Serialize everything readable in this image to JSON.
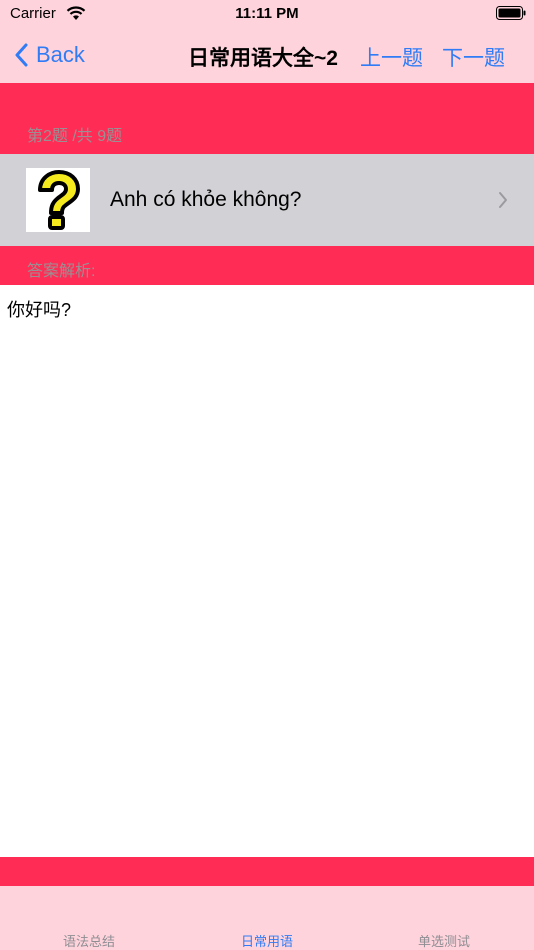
{
  "status_bar": {
    "carrier": "Carrier",
    "time": "11:11 PM"
  },
  "nav": {
    "back_label": "Back",
    "title": "日常用语大全~2",
    "prev_label": "上一题",
    "next_label": "下一题"
  },
  "question_section": {
    "header": "第2题 /共 9题"
  },
  "question": {
    "image_icon": "question-mark-icon",
    "text": "Anh có khỏe không?"
  },
  "answer_section": {
    "header": "答案解析:",
    "text": "你好吗?"
  },
  "tabs": [
    {
      "label": "语法总结",
      "active": false
    },
    {
      "label": "日常用语",
      "active": true
    },
    {
      "label": "单选测试",
      "active": false
    }
  ],
  "colors": {
    "accent": "#2f7cf6",
    "bar_background": "#ffd3dc",
    "section_red": "#ff2d55",
    "row_gray": "#d1d1d6"
  }
}
